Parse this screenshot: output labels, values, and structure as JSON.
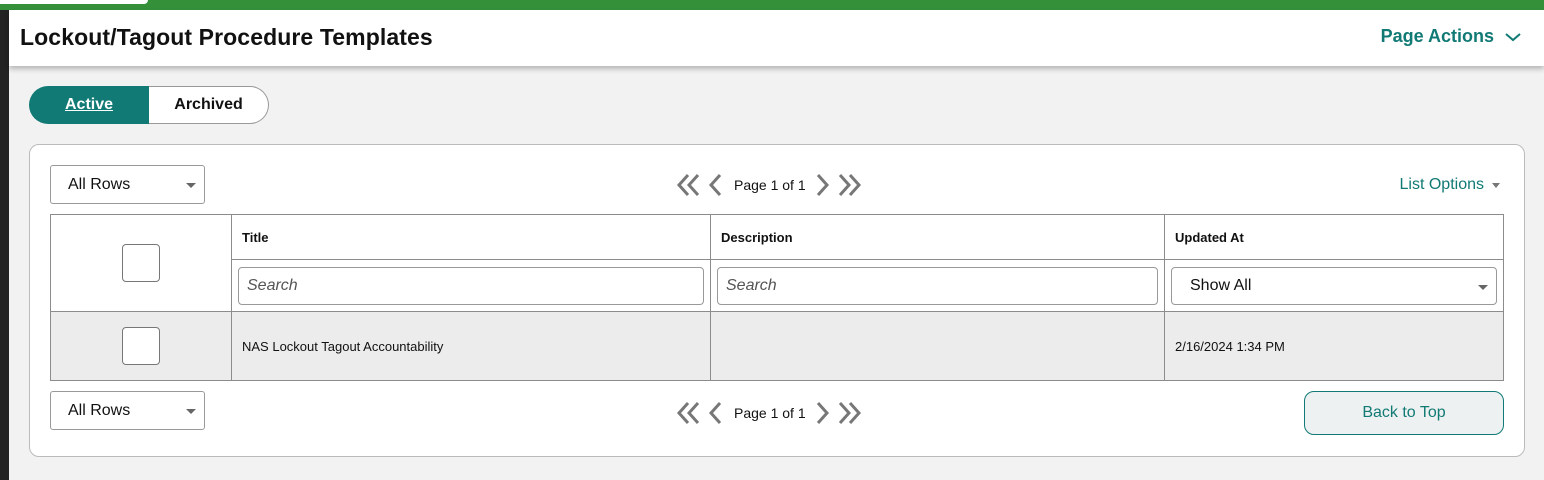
{
  "header": {
    "title": "Lockout/Tagout Procedure Templates",
    "page_actions_label": "Page Actions"
  },
  "tabs": [
    {
      "label": "Active",
      "selected": true
    },
    {
      "label": "Archived",
      "selected": false
    }
  ],
  "controls": {
    "rows_select_top": "All Rows",
    "rows_select_bottom": "All Rows",
    "page_label": "Page 1 of 1",
    "list_options_label": "List Options",
    "back_to_top_label": "Back to Top"
  },
  "table": {
    "columns": [
      "Title",
      "Description",
      "Updated At"
    ],
    "filters": {
      "title_placeholder": "Search",
      "description_placeholder": "Search",
      "updated_at_value": "Show All"
    },
    "rows": [
      {
        "title": "NAS Lockout Tagout Accountability",
        "description": "",
        "updated_at": "2/16/2024 1:34 PM"
      }
    ]
  },
  "colors": {
    "accent": "#117a75",
    "topbar": "#34913a",
    "leftbar": "#232323"
  },
  "icons": [
    "chevron-down-icon",
    "double-chevron-left-icon",
    "chevron-left-icon",
    "chevron-right-icon",
    "double-chevron-right-icon",
    "caret-down-icon"
  ]
}
